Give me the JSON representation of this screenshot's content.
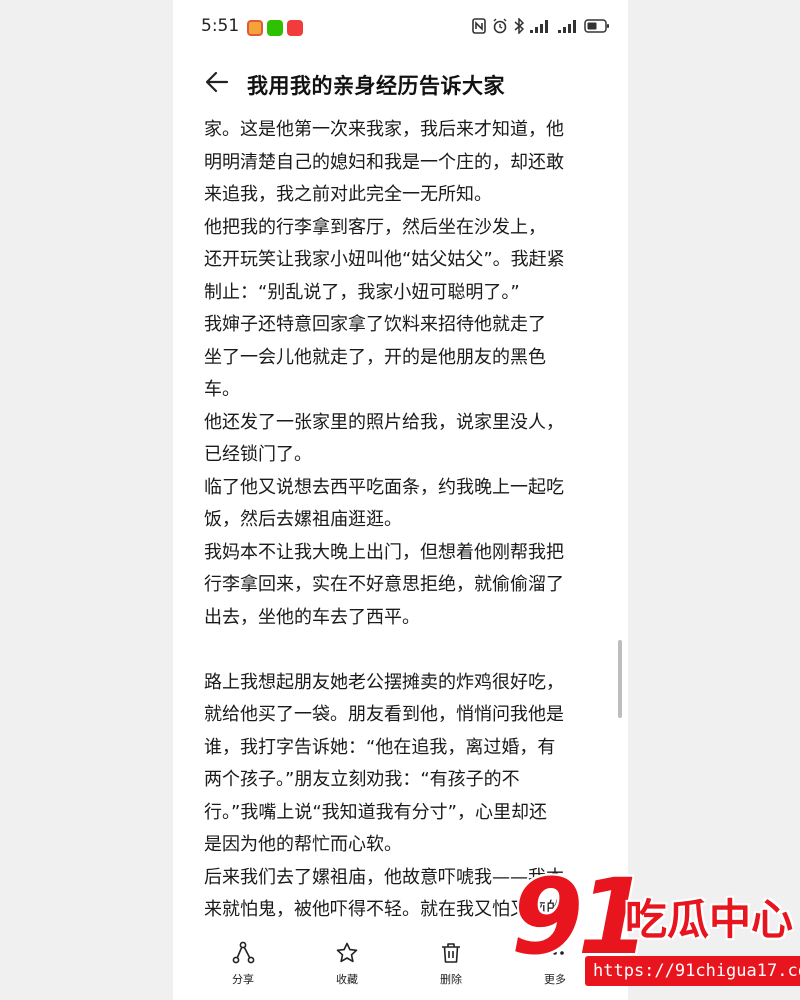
{
  "status_bar": {
    "time": "5:51",
    "notification_icons": [
      "weibo-app-icon",
      "wechat-app-icon",
      "red-app-icon"
    ],
    "right_icons": [
      "nfc-icon",
      "alarm-icon",
      "bluetooth-icon",
      "signal-icon",
      "signal-icon",
      "battery-icon"
    ]
  },
  "header": {
    "title": "我用我的亲身经历告诉大家"
  },
  "article": {
    "lines": [
      "家。这是他第一次来我家，我后来才知道，他",
      "明明清楚自己的媳妇和我是一个庄的，却还敢",
      "来追我，我之前对此完全一无所知。",
      " 他把我的行李拿到客厅，然后坐在沙发上，",
      "还开玩笑让我家小妞叫他“姑父姑父”。我赶紧",
      "制止：“别乱说了，我家小妞可聪明了。”",
      "我婶子还特意回家拿了饮料来招待他就走了",
      " 坐了一会儿他就走了，开的是他朋友的黑色",
      "车。",
      "他还发了一张家里的照片给我，说家里没人，",
      "已经锁门了。",
      "临了他又说想去西平吃面条，约我晚上一起吃",
      "饭，然后去嫘祖庙逛逛。",
      "我妈本不让我大晚上出门，但想着他刚帮我把",
      "行李拿回来，实在不好意思拒绝，就偷偷溜了",
      "出去，坐他的车去了西平。",
      "",
      "路上我想起朋友她老公摆摊卖的炸鸡很好吃，",
      "就给他买了一袋。朋友看到他，悄悄问我他是",
      "谁，我打字告诉她：“他在追我，离过婚，有",
      "两个孩子。”朋友立刻劝我：“有孩子的不",
      "行。”我嘴上说“我知道我有分寸”，心里却还",
      "是因为他的帮忙而心软。",
      "后来我们去了嫘祖庙，他故意吓唬我——我本",
      "来就怕鬼，被他吓得不轻。就在我又怕又恼的"
    ]
  },
  "toolbar": {
    "share_label": "分享",
    "favorite_label": "收藏",
    "delete_label": "删除",
    "more_label": "更多"
  },
  "watermark": {
    "number": "91",
    "text": "吃瓜中心",
    "url": "https://91chigua17.com"
  },
  "colors": {
    "watermark_red": "#e8141e",
    "background": "#ffffff",
    "text": "#1a1a1a"
  }
}
